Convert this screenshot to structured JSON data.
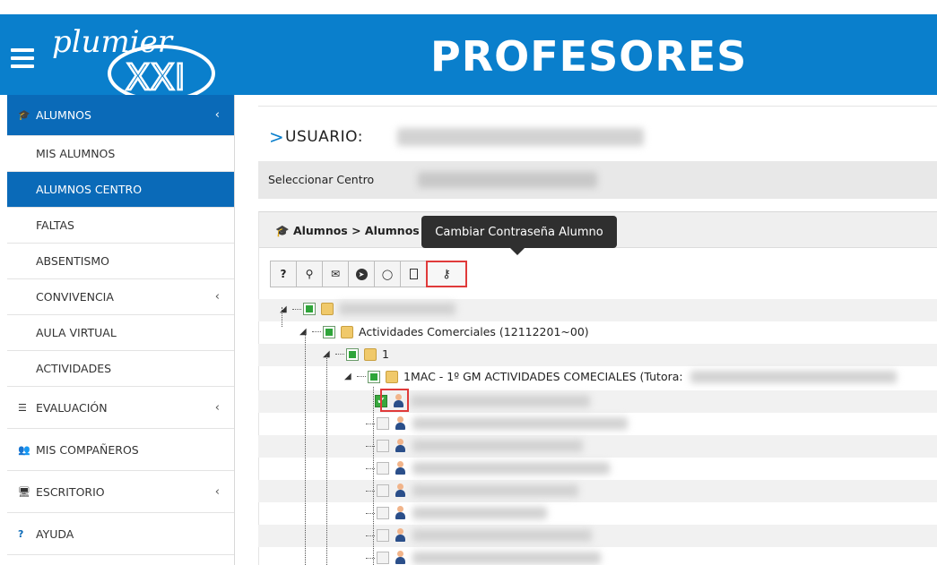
{
  "header": {
    "title": "PROFESORES",
    "logo_text": "plumier",
    "logo_suffix": "XXI"
  },
  "sidebar": {
    "items": [
      {
        "label": "ALUMNOS",
        "type": "head",
        "chevron": "‹"
      },
      {
        "label": "MIS ALUMNOS",
        "type": "sub"
      },
      {
        "label": "ALUMNOS CENTRO",
        "type": "sub-active"
      },
      {
        "label": "FALTAS",
        "type": "sub"
      },
      {
        "label": "ABSENTISMO",
        "type": "sub"
      },
      {
        "label": "CONVIVENCIA",
        "type": "sub",
        "chevron": "‹"
      },
      {
        "label": "AULA VIRTUAL",
        "type": "sub"
      },
      {
        "label": "ACTIVIDADES",
        "type": "sub"
      },
      {
        "label": "EVALUACIÓN",
        "type": "section",
        "chevron": "‹"
      },
      {
        "label": "MIS COMPAÑEROS",
        "type": "section"
      },
      {
        "label": "ESCRITORIO",
        "type": "section",
        "chevron": "‹"
      },
      {
        "label": "AYUDA",
        "type": "section",
        "icon": "?"
      }
    ]
  },
  "user": {
    "label": "USUARIO:"
  },
  "center": {
    "label": "Seleccionar Centro"
  },
  "panel": {
    "breadcrumb": "Alumnos > Alumnos"
  },
  "toolbar": {
    "buttons": [
      {
        "icon": "?",
        "name": "help-icon"
      },
      {
        "icon": "🔍",
        "name": "search-icon"
      },
      {
        "icon": "✉",
        "name": "mail-icon"
      },
      {
        "icon": "➤",
        "name": "telegram-icon"
      },
      {
        "icon": "💬",
        "name": "chat-icon"
      },
      {
        "icon": "🗋",
        "name": "document-icon"
      },
      {
        "icon": "🔑",
        "name": "key-icon"
      }
    ]
  },
  "tooltip": {
    "text": "Cambiar Contraseña Alumno"
  },
  "tree": {
    "level1_label": "Actividades Comerciales (12112201~00)",
    "level2_label": "1",
    "level3_label": "1MAC - 1º GM ACTIVIDADES COMECIALES (Tutora:"
  }
}
